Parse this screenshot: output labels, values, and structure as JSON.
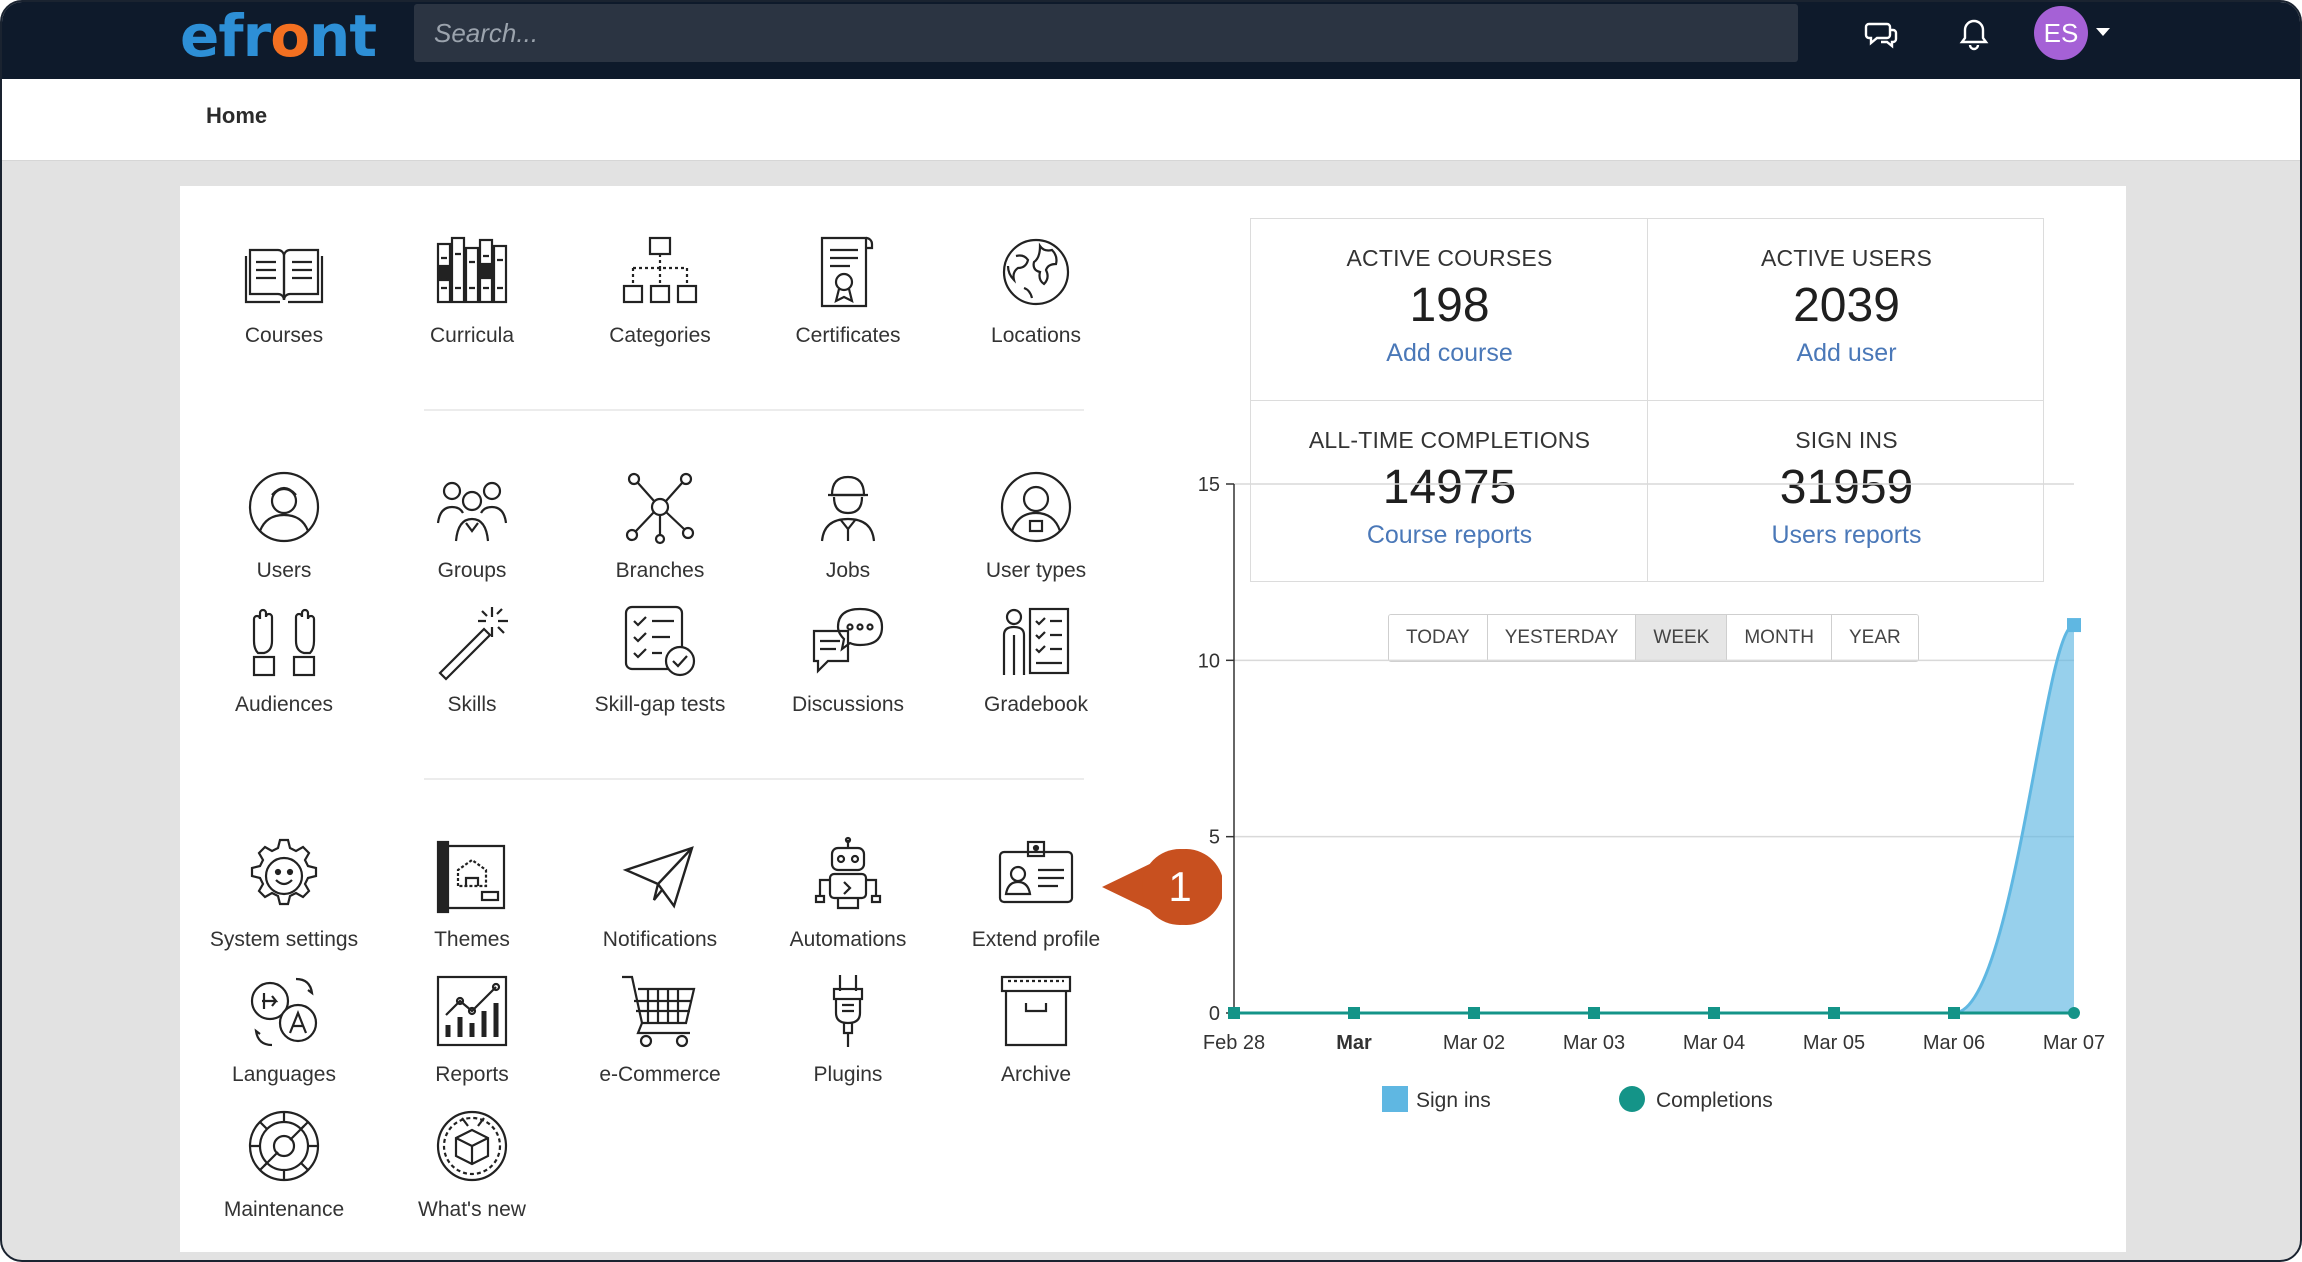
{
  "app": {
    "logo_pre": "efr",
    "logo_o": "o",
    "logo_post": "nt"
  },
  "topbar": {
    "search_placeholder": "Search...",
    "avatar_initials": "ES"
  },
  "breadcrumb": {
    "home": "Home"
  },
  "tiles": {
    "courses": "Courses",
    "curricula": "Curricula",
    "categories": "Categories",
    "certificates": "Certificates",
    "locations": "Locations",
    "users": "Users",
    "groups": "Groups",
    "branches": "Branches",
    "jobs": "Jobs",
    "user_types": "User types",
    "audiences": "Audiences",
    "skills": "Skills",
    "skill_gap": "Skill-gap tests",
    "discussions": "Discussions",
    "gradebook": "Gradebook",
    "system_settings": "System settings",
    "themes": "Themes",
    "notifications": "Notifications",
    "automations": "Automations",
    "extend_profile": "Extend profile",
    "languages": "Languages",
    "reports": "Reports",
    "ecommerce": "e-Commerce",
    "plugins": "Plugins",
    "archive": "Archive",
    "maintenance": "Maintenance",
    "whats_new": "What's new"
  },
  "stats": {
    "active_courses": {
      "title": "ACTIVE COURSES",
      "value": "198",
      "link": "Add course"
    },
    "active_users": {
      "title": "ACTIVE USERS",
      "value": "2039",
      "link": "Add user"
    },
    "completions": {
      "title": "ALL-TIME COMPLETIONS",
      "value": "14975",
      "link": "Course reports"
    },
    "sign_ins": {
      "title": "SIGN INS",
      "value": "31959",
      "link": "Users reports"
    }
  },
  "periods": {
    "today": "TODAY",
    "yesterday": "YESTERDAY",
    "week": "WEEK",
    "month": "MONTH",
    "year": "YEAR",
    "active": "WEEK"
  },
  "callout": {
    "number": "1"
  },
  "colors": {
    "sign_ins": "#5fb7e2",
    "completions": "#149488",
    "link": "#4a78b8",
    "topbar": "#0e1a2b",
    "callout": "#c8501f"
  },
  "chart_data": {
    "type": "area",
    "categories": [
      "Feb 28",
      "Mar",
      "Mar 02",
      "Mar 03",
      "Mar 04",
      "Mar 05",
      "Mar 06",
      "Mar 07"
    ],
    "yticks": [
      "0",
      "5",
      "10",
      "15"
    ],
    "ylim": [
      0,
      15
    ],
    "grid": true,
    "legend": "bottom",
    "series": [
      {
        "name": "Sign ins",
        "values": [
          0,
          0,
          0,
          0,
          0,
          0,
          0,
          11
        ]
      },
      {
        "name": "Completions",
        "values": [
          0,
          0,
          0,
          0,
          0,
          0,
          0,
          0
        ]
      }
    ]
  }
}
